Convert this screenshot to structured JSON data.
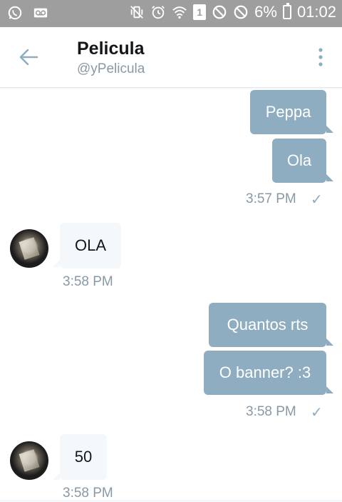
{
  "status_bar": {
    "battery": "6%",
    "time": "01:02",
    "sim_slot": "1",
    "icons": [
      "whatsapp-icon",
      "voicemail-icon",
      "vibrate-mute-icon",
      "alarm-icon",
      "wifi-icon",
      "sim-icon",
      "block-icon",
      "block-icon",
      "battery-icon"
    ]
  },
  "header": {
    "title": "Pelicula",
    "handle": "@yPelicula",
    "back_icon": "back-arrow-icon",
    "menu_icon": "more-vertical-icon"
  },
  "colors": {
    "outgoing_bubble": "#8fadc1",
    "incoming_bubble": "#f5f8fa",
    "muted_text": "#8899a6",
    "status_bar": "#9e9e9e"
  },
  "messages": [
    {
      "direction": "out",
      "text": "Peppa"
    },
    {
      "direction": "out",
      "text": "Ola",
      "time": "3:57 PM",
      "read": true
    },
    {
      "direction": "in",
      "text": "OLA",
      "time": "3:58 PM"
    },
    {
      "direction": "out",
      "text": "Quantos rts"
    },
    {
      "direction": "out",
      "text": "O banner? :3",
      "time": "3:58 PM",
      "read": true
    },
    {
      "direction": "in",
      "text": "50",
      "time": "3:58 PM"
    }
  ]
}
